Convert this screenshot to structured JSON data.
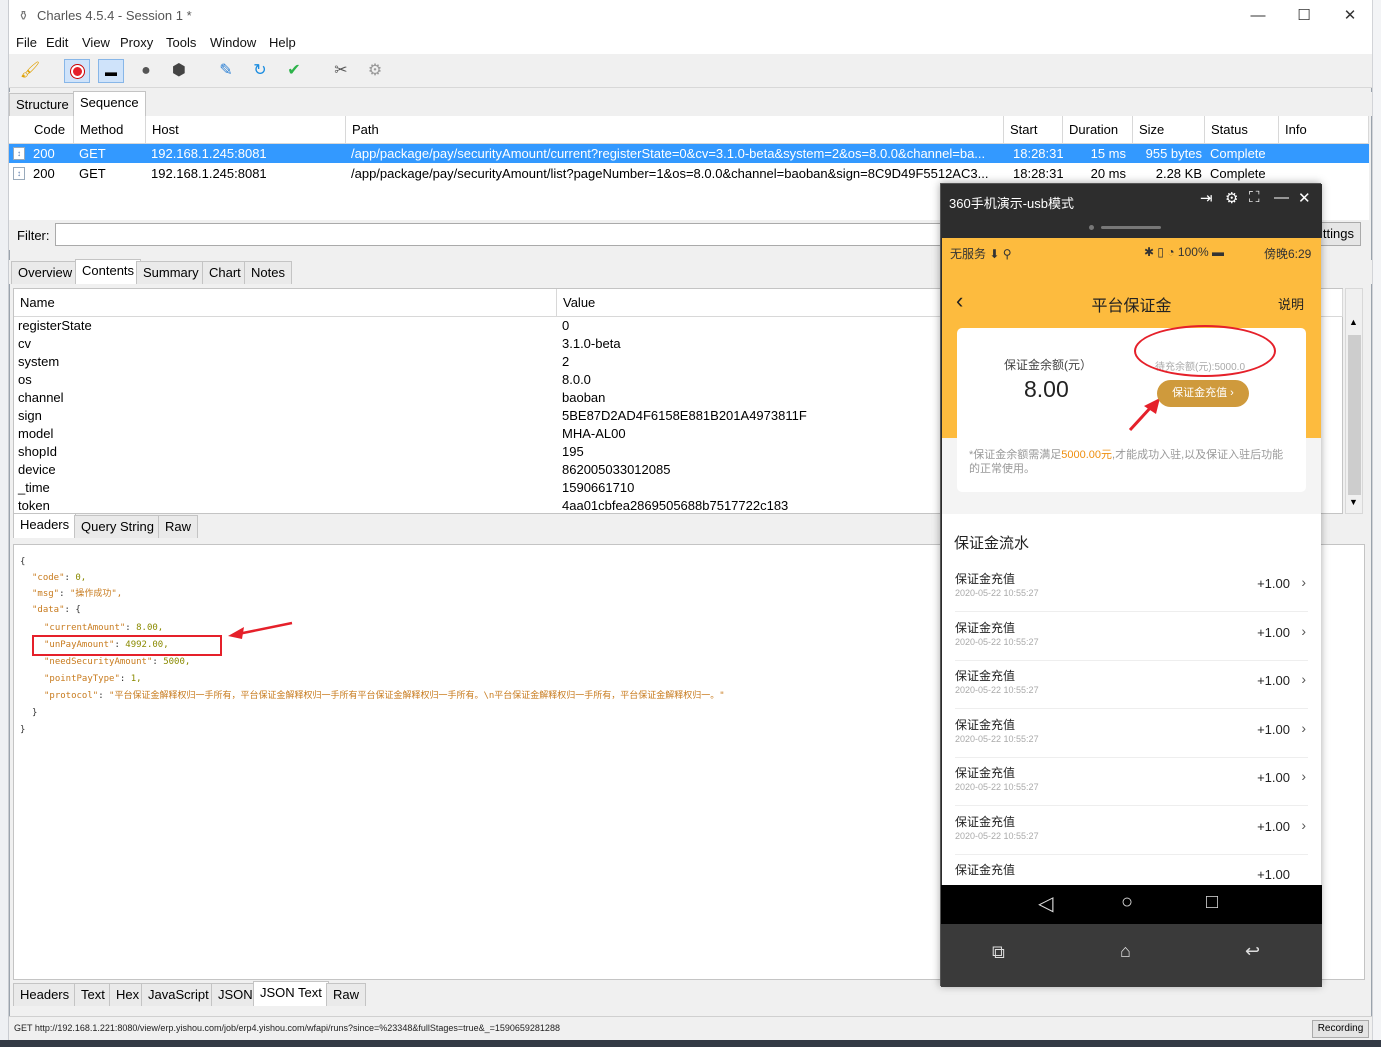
{
  "window": {
    "title": "Charles 4.5.4 - Session 1 *"
  },
  "menu": [
    "File",
    "Edit",
    "View",
    "Proxy",
    "Tools",
    "Window",
    "Help"
  ],
  "view_tabs": [
    "Structure",
    "Sequence"
  ],
  "sequence": {
    "columns": [
      "Code",
      "Method",
      "Host",
      "Path",
      "Start",
      "Duration",
      "Size",
      "Status",
      "Info"
    ],
    "rows": [
      {
        "code": "200",
        "method": "GET",
        "host": "192.168.1.245:8081",
        "path": "/app/package/pay/securityAmount/current?registerState=0&cv=3.1.0-beta&system=2&os=8.0.0&channel=ba...",
        "start": "18:28:31",
        "duration": "15 ms",
        "size": "955 bytes",
        "status": "Complete",
        "info": ""
      },
      {
        "code": "200",
        "method": "GET",
        "host": "192.168.1.245:8081",
        "path": "/app/package/pay/securityAmount/list?pageNumber=1&os=8.0.0&channel=baoban&sign=8C9D49F5512AC3...",
        "start": "18:28:31",
        "duration": "20 ms",
        "size": "2.28 KB",
        "status": "Complete",
        "info": ""
      }
    ]
  },
  "filter": {
    "label": "Filter:",
    "value": "",
    "settings": "ttings"
  },
  "detail_tabs": [
    "Overview",
    "Contents",
    "Summary",
    "Chart",
    "Notes"
  ],
  "query": {
    "columns": [
      "Name",
      "Value"
    ],
    "rows": [
      {
        "name": "registerState",
        "value": "0"
      },
      {
        "name": "cv",
        "value": "3.1.0-beta"
      },
      {
        "name": "system",
        "value": "2"
      },
      {
        "name": "os",
        "value": "8.0.0"
      },
      {
        "name": "channel",
        "value": "baoban"
      },
      {
        "name": "sign",
        "value": "5BE87D2AD4F6158E881B201A4973811F"
      },
      {
        "name": "model",
        "value": "MHA-AL00"
      },
      {
        "name": "shopId",
        "value": "195"
      },
      {
        "name": "device",
        "value": "862005033012085"
      },
      {
        "name": "_time",
        "value": "1590661710"
      },
      {
        "name": "token",
        "value": "4aa01cbfea2869505688b7517722c183"
      }
    ]
  },
  "request_tabs": [
    "Headers",
    "Query String",
    "Raw"
  ],
  "json_lines": [
    {
      "indent": 0,
      "t": "{"
    },
    {
      "indent": 1,
      "k": "\"code\"",
      "v": "0,"
    },
    {
      "indent": 1,
      "k": "\"msg\"",
      "s": "\"操作成功\","
    },
    {
      "indent": 1,
      "k": "\"data\"",
      "t2": "{"
    },
    {
      "indent": 2,
      "k": "\"currentAmount\"",
      "v": "8.00,"
    },
    {
      "indent": 2,
      "k": "\"unPayAmount\"",
      "v": "4992.00,"
    },
    {
      "indent": 2,
      "k": "\"needSecurityAmount\"",
      "v": "5000,"
    },
    {
      "indent": 2,
      "k": "\"pointPayType\"",
      "v": "1,"
    },
    {
      "indent": 2,
      "k": "\"protocol\"",
      "s": "\"平台保证金解释权归一手所有，平台保证金解释权归一手所有平台保证金解释权归一手所有。\\n平台保证金解释权归一手所有，平台保证金解释权归一。\""
    },
    {
      "indent": 1,
      "t": "}"
    },
    {
      "indent": 0,
      "t": "}"
    }
  ],
  "response_tabs": [
    "Headers",
    "Text",
    "Hex",
    "JavaScript",
    "JSON",
    "JSON Text",
    "Raw"
  ],
  "status": {
    "url": "GET http://192.168.1.221:8080/view/erp.yishou.com/job/erp4.yishou.com/wfapi/runs?since=%23348&fullStages=true&_=1590659281288",
    "recording": "Recording"
  },
  "phone": {
    "title": "360手机演示-usb模式",
    "statusbar": {
      "left": "无服务",
      "battery": "100%",
      "time": "傍晚6:29"
    },
    "nav": {
      "title": "平台保证金",
      "action": "说明"
    },
    "balance_label": "保证金余额(元）",
    "balance": "8.00",
    "pending": "待充余额(元):5000.0",
    "recharge": "保证金充值 ›",
    "note_pre": "*保证金余额需满足",
    "note_hl": "5000.00元",
    "note_post": ",才能成功入驻,以及保证入驻后功能的正常使用。",
    "flow_title": "保证金流水",
    "flows": [
      {
        "t": "保证金充值",
        "d": "2020-05-22 10:55:27",
        "a": "+1.00"
      },
      {
        "t": "保证金充值",
        "d": "2020-05-22 10:55:27",
        "a": "+1.00"
      },
      {
        "t": "保证金充值",
        "d": "2020-05-22 10:55:27",
        "a": "+1.00"
      },
      {
        "t": "保证金充值",
        "d": "2020-05-22 10:55:27",
        "a": "+1.00"
      },
      {
        "t": "保证金充值",
        "d": "2020-05-22 10:55:27",
        "a": "+1.00"
      },
      {
        "t": "保证金充值",
        "d": "2020-05-22 10:55:27",
        "a": "+1.00"
      },
      {
        "t": "保证金充值",
        "d": "",
        "a": "+1.00"
      }
    ]
  },
  "colors": {
    "selection": "#3399ff",
    "annotation": "#e5202a",
    "phone_header": "#fdbb3e"
  }
}
